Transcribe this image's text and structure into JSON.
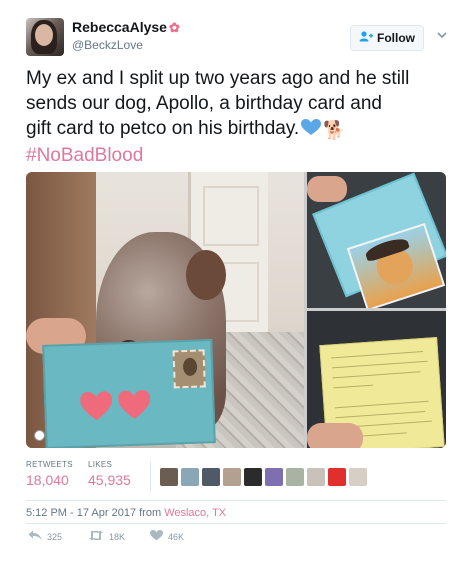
{
  "user": {
    "display_name": "RebeccaAlyse",
    "display_name_emoji": "✿",
    "handle": "@BeckzLove"
  },
  "follow_button": {
    "label": "Follow",
    "icon": "add-person-icon"
  },
  "tweet": {
    "line1": "My ex and I split up two years ago and he still",
    "line2": "sends our dog, Apollo, a birthday card and",
    "line3": "gift card to petco on his birthday.",
    "emoji_heart": "blue-heart",
    "emoji_dog": "🐕",
    "hashtag": "#NoBadBlood"
  },
  "stats": {
    "retweets_label": "RETWEETS",
    "retweets_value": "18,040",
    "likes_label": "LIKES",
    "likes_value": "45,935"
  },
  "timestamp": {
    "time_date": "5:12 PM - 17 Apr 2017 from ",
    "location": "Weslaco, TX"
  },
  "actions": {
    "reply_count": "325",
    "retweet_count": "18K",
    "like_count": "46K"
  },
  "colors": {
    "accent_pink": "#e0789b",
    "twitter_blue": "#1da1f2",
    "heart_blue": "#5aa7e8"
  }
}
